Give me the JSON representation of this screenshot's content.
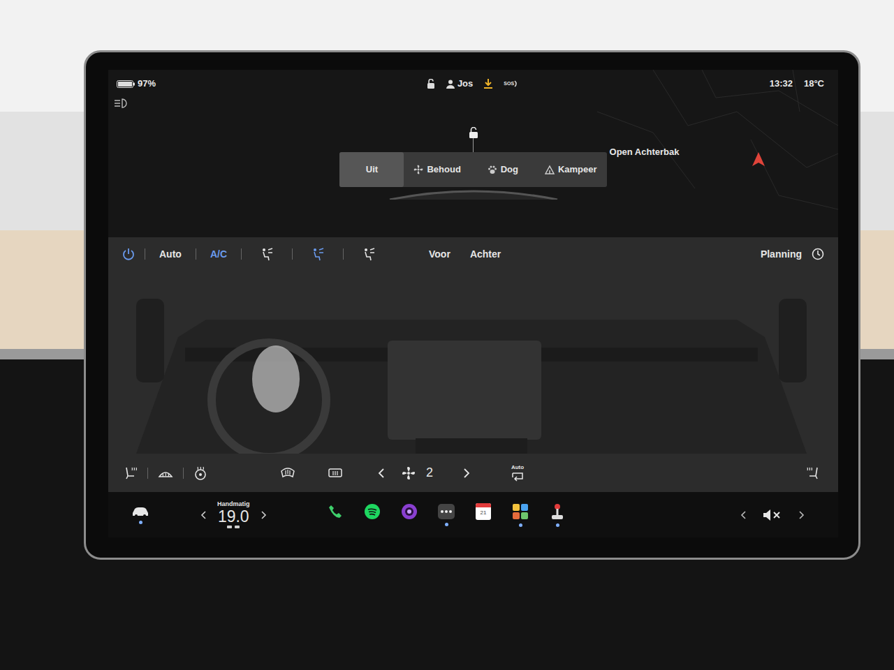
{
  "status_bar": {
    "battery": "97%",
    "user": "Jos",
    "sos": "SOS",
    "time": "13:32",
    "temperature": "18°C"
  },
  "car_modes": [
    {
      "label": "Uit",
      "kind": "off",
      "selected": true
    },
    {
      "label": "Behoud",
      "kind": "keep",
      "selected": false
    },
    {
      "label": "Dog",
      "kind": "dog",
      "selected": false
    },
    {
      "label": "Kampeer",
      "kind": "camp",
      "selected": false
    }
  ],
  "trunk": {
    "label": "Open Achterbak"
  },
  "climate": {
    "power_on": true,
    "auto": {
      "label": "Auto"
    },
    "ac": {
      "label": "A/C",
      "on": true
    },
    "airflow": [
      {
        "selected": false
      },
      {
        "selected": true
      },
      {
        "selected": false
      }
    ],
    "zones": [
      {
        "label": "Voor"
      },
      {
        "label": "Achter"
      }
    ],
    "planning": "Planning",
    "fan_speed": "2",
    "recirculation": "Auto"
  },
  "dock": {
    "car_dot": true,
    "temperature_mode": "Handmatig",
    "temperature": "19.0",
    "muted": true,
    "apps": [
      {
        "kind": "phone",
        "dot": false
      },
      {
        "kind": "spotify",
        "dot": false
      },
      {
        "kind": "camera",
        "dot": false
      },
      {
        "kind": "more",
        "dot": true
      },
      {
        "kind": "calendar",
        "dot": false,
        "text": "21"
      },
      {
        "kind": "apps",
        "dot": true
      },
      {
        "kind": "game",
        "dot": true
      }
    ]
  }
}
